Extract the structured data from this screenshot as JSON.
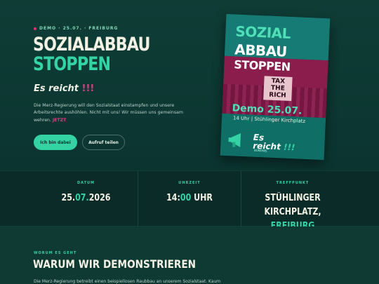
{
  "hero": {
    "eyebrow": "DEMO · 25.07. · FREIBURG",
    "title_line1": "SOZIALABBAU",
    "title_line2": "STOPPEN",
    "tagline": "Es reicht",
    "tagline_excl": "!!!",
    "body": "Die Merz-Regierung will den Sozialstaat einstampfen und unsere Arbeitsrechte aushöhlen. Nicht mit uns! Wir müssen uns gemeinsam wehren.",
    "body_highlight": "JETZT",
    "primary_button": "Ich bin dabei",
    "secondary_button": "Aufruf teilen"
  },
  "poster": {
    "line1": "SOZIAL",
    "line2": "ABBAU",
    "line3": "STOPPEN",
    "sign": "TAX THE RICH",
    "date": "Demo 25.07.",
    "place": "14 Uhr | Stühlinger Kirchplatz",
    "slogan_line1": "Es",
    "slogan_line2": "reicht",
    "slogan_excl": "!!!",
    "slogan_sub": "BÜNDNIS",
    "megaphone_icon": "megaphone-icon"
  },
  "info": {
    "date_label": "DATUM",
    "date_day": "25.",
    "date_month": "07.",
    "date_year": "2026",
    "time_label": "UHRZEIT",
    "time_hour": "14:",
    "time_min": "00",
    "time_unit": " UHR",
    "place_label": "TREFFPUNKT",
    "place_line1": "STÜHLINGER",
    "place_line2": "KIRCHPLATZ,",
    "place_city": "FREIBURG"
  },
  "section": {
    "kicker": "WORUM ES GEHT",
    "title": "WARUM WIR DEMONSTRIEREN",
    "text": "Die Merz-Regierung betreibt einen beispiellosen Raubbau an unserem Sozialstaat. Kaum"
  },
  "colors": {
    "accent": "#34d3a4",
    "highlight": "#e23b85",
    "background": "#0e3a33"
  }
}
